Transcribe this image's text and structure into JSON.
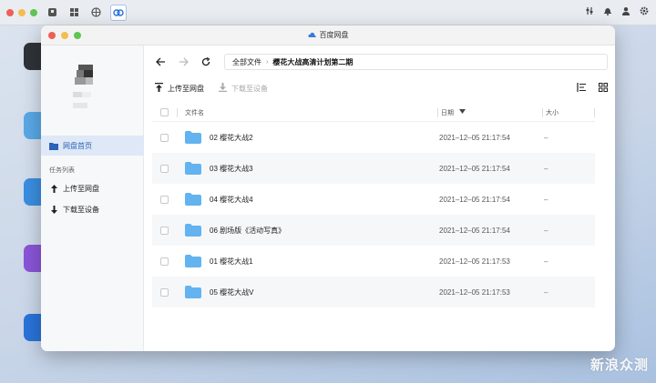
{
  "topbar": {
    "icons": [
      "storage-icon",
      "apps-grid-icon",
      "network-icon",
      "baidu-cloud-icon"
    ],
    "right_icons": [
      "sliders-icon",
      "bell-icon",
      "user-icon",
      "gear-icon"
    ]
  },
  "window": {
    "title": "百度网盘"
  },
  "sidebar": {
    "items": [
      {
        "label": "网盘首页",
        "icon": "folder-icon"
      }
    ],
    "section_label": "任务列表",
    "tasks": [
      {
        "label": "上传至网盘",
        "icon": "upload-icon"
      },
      {
        "label": "下载至设备",
        "icon": "download-icon"
      }
    ]
  },
  "breadcrumb": {
    "root": "全部文件",
    "separator": "›",
    "current": "樱花大战高清计划第二期"
  },
  "toolbar": {
    "upload_label": "上传至网盘",
    "download_label": "下载至设备"
  },
  "table": {
    "headers": {
      "name": "文件名",
      "date": "日期",
      "size": "大小"
    },
    "rows": [
      {
        "name": "02 樱花大战2",
        "date": "2021–12–05 21:17:54",
        "size": "–"
      },
      {
        "name": "03 樱花大战3",
        "date": "2021–12–05 21:17:54",
        "size": "–"
      },
      {
        "name": "04 樱花大战4",
        "date": "2021–12–05 21:17:54",
        "size": "–"
      },
      {
        "name": "06 剧场版《活动写真》",
        "date": "2021–12–05 21:17:54",
        "size": "–"
      },
      {
        "name": "01 樱花大战1",
        "date": "2021–12–05 21:17:53",
        "size": "–"
      },
      {
        "name": "05 樱花大战V",
        "date": "2021–12–05 21:17:53",
        "size": "–"
      }
    ]
  },
  "watermark": "新浪众测",
  "colors": {
    "accent": "#2a63b8",
    "folder": "#63b3f0",
    "selected_bg": "#dfe8f6"
  }
}
